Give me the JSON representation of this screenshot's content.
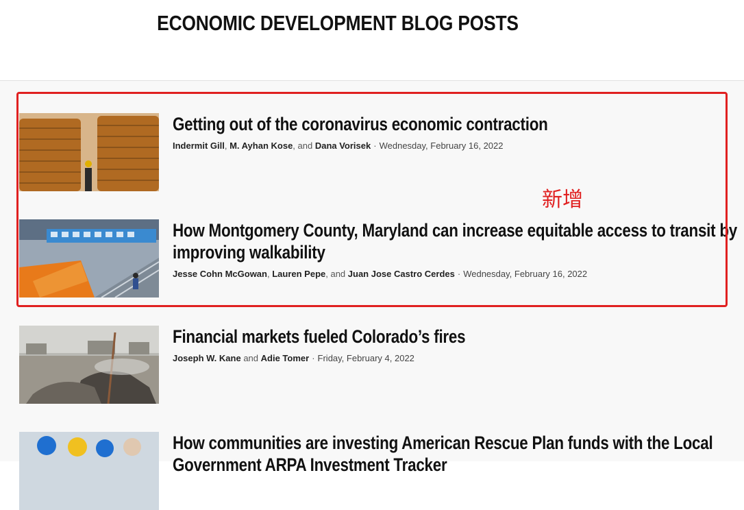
{
  "header": {
    "title": "ECONOMIC DEVELOPMENT BLOG POSTS"
  },
  "annotation": {
    "label": "新增",
    "color": "#e02020"
  },
  "posts": [
    {
      "title": "Getting out of the coronavirus economic contraction",
      "authors": [
        "Indermit Gill",
        "M. Ayhan Kose",
        "Dana Vorisek"
      ],
      "author_seps": [
        ", ",
        ", and "
      ],
      "date": "Wednesday, February 16, 2022",
      "image": "image of stacked grain sacks with a worker"
    },
    {
      "title": "How Montgomery County, Maryland can increase equitable access to transit by improving walkability",
      "authors": [
        "Jesse Cohn McGowan",
        "Lauren Pepe",
        "Juan Jose Castro Cerdes"
      ],
      "author_seps": [
        ", ",
        ", and "
      ],
      "date": "Wednesday, February 16, 2022",
      "image": "image of a metro station platform with escalators"
    },
    {
      "title": "Financial markets fueled Colorado’s fires",
      "authors": [
        "Joseph W. Kane",
        "Adie Tomer"
      ],
      "author_seps": [
        " and "
      ],
      "date": "Friday, February 4, 2022",
      "image": "image of burned cars and wildfire aftermath"
    },
    {
      "title": "How communities are investing American Rescue Plan funds with the Local Government ARPA Investment Tracker",
      "authors": [],
      "author_seps": [],
      "date": "",
      "image": "image of workers wearing hard hats and masks"
    }
  ]
}
